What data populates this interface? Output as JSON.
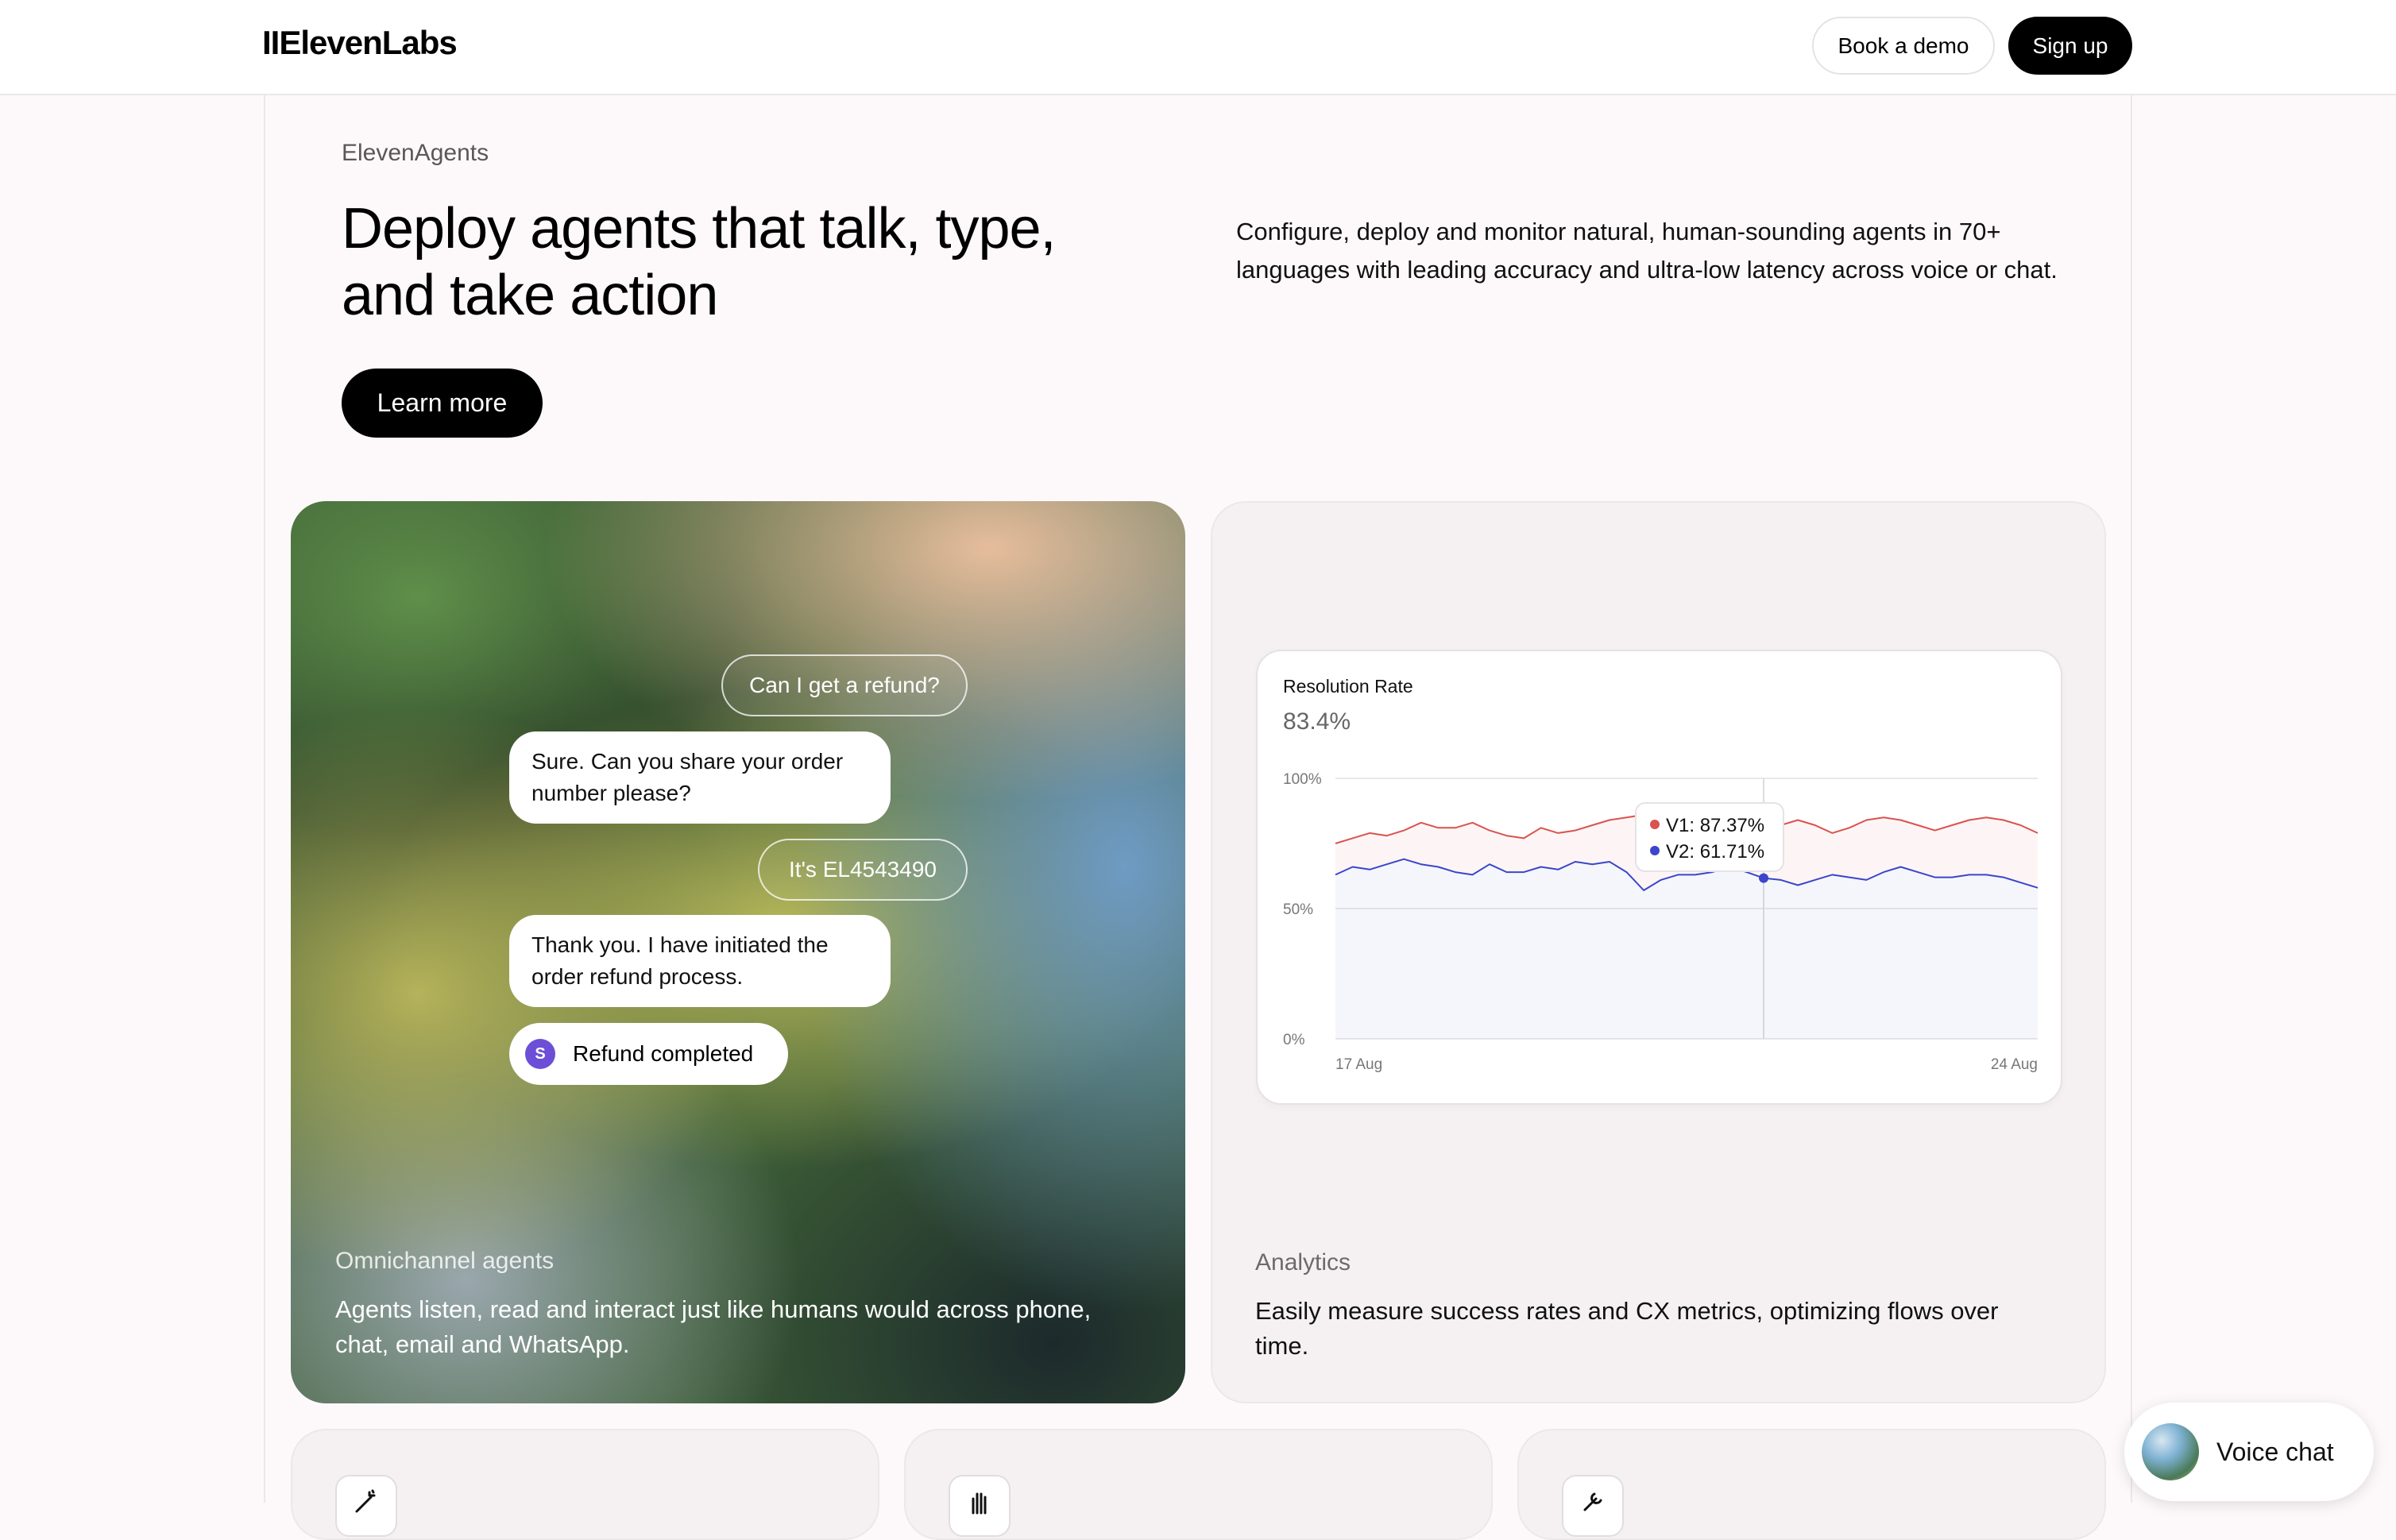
{
  "header": {
    "logo": "IIElevenLabs",
    "book_demo": "Book a demo",
    "sign_up": "Sign up"
  },
  "hero": {
    "eyebrow": "ElevenAgents",
    "headline": "Deploy agents that talk, type, and take action",
    "learn_more": "Learn more",
    "description": "Configure, deploy and monitor natural, human-sounding agents in 70+ languages with leading accuracy and ultra-low latency across voice or chat."
  },
  "omnichannel": {
    "conversation": {
      "user_1": "Can I get a refund?",
      "agent_1": "Sure. Can you share your order number please?",
      "user_2": "It's EL4543490",
      "agent_2": "Thank you. I have initiated the order refund process.",
      "status_icon": "S",
      "status": "Refund completed"
    },
    "label": "Omnichannel agents",
    "text": "Agents listen, read and interact just like humans would across phone, chat, email and WhatsApp."
  },
  "analytics": {
    "label": "Analytics",
    "text": "Easily measure success rates and CX metrics, optimizing flows over time.",
    "chart_title": "Resolution Rate",
    "chart_value": "83.4%",
    "tooltip_v1": "V1: 87.37%",
    "tooltip_v2": "V2: 61.71%"
  },
  "chart_data": {
    "type": "area",
    "title": "Resolution Rate",
    "subtitle": "83.4%",
    "y_ticks": [
      "100%",
      "50%",
      "0%"
    ],
    "x_ticks": [
      "17 Aug",
      "24 Aug"
    ],
    "ylim": [
      0,
      100
    ],
    "grid": true,
    "series": [
      {
        "name": "V1",
        "color": "#d9534f",
        "values": [
          75,
          77,
          79,
          78,
          80,
          83,
          81,
          81,
          83,
          80,
          78,
          77,
          81,
          79,
          80,
          82,
          84,
          85,
          86,
          83,
          79,
          79,
          82,
          84,
          85,
          87.37,
          82,
          84,
          82,
          79,
          81,
          84,
          85,
          84,
          82,
          80,
          82,
          84,
          85,
          84,
          82,
          79
        ]
      },
      {
        "name": "V2",
        "color": "#3b46c9",
        "values": [
          63,
          66,
          65,
          67,
          69,
          67,
          66,
          64,
          63,
          67,
          64,
          64,
          66,
          65,
          68,
          67,
          68,
          64,
          57,
          61,
          63,
          63,
          64,
          66,
          64,
          61.71,
          61,
          59,
          61,
          63,
          62,
          61,
          64,
          66,
          64,
          62,
          62,
          63,
          63,
          62,
          60,
          58
        ]
      }
    ],
    "tooltip": {
      "V1": "87.37%",
      "V2": "61.71%"
    }
  },
  "bottom_cards": [
    {
      "icon": "wand-icon"
    },
    {
      "icon": "hand-icon"
    },
    {
      "icon": "tool-icon"
    }
  ],
  "voice_chat": {
    "label": "Voice chat"
  },
  "colors": {
    "accent": "#000000",
    "v1": "#d9534f",
    "v2": "#3b46c9",
    "status_icon": "#6c4fd6"
  }
}
